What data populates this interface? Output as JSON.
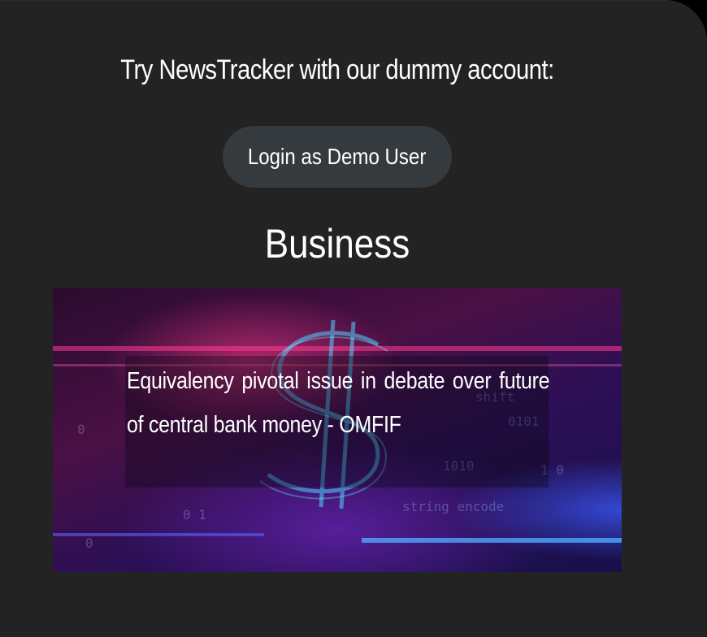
{
  "intro": {
    "text": "Try NewsTracker with our dummy account:"
  },
  "demo_login": {
    "label": "Login as Demo User"
  },
  "section": {
    "title": "Business"
  },
  "article": {
    "headline": "Equivalency pivotal issue in debate over future of central bank money - OMFIF",
    "image_icon": "dollar-sign-icon"
  },
  "colors": {
    "page_background": "#232323",
    "button_background": "#353a3f",
    "text": "#ffffff"
  }
}
